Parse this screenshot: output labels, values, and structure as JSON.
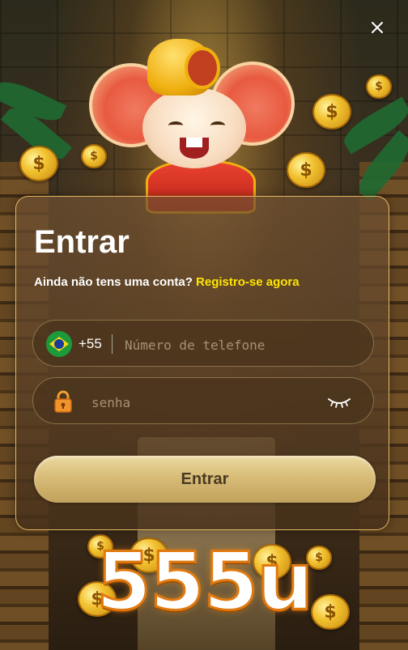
{
  "dialog": {
    "title": "Entrar",
    "register_prompt": "Ainda não tens uma conta?",
    "register_link": "Registro-se agora",
    "country_code": "+55",
    "phone_placeholder": "Número de telefone",
    "password_placeholder": "senha",
    "submit_label": "Entrar"
  },
  "brand": {
    "logo_text": "555u"
  },
  "icons": {
    "close": "close-icon",
    "flag": "brazil-flag-icon",
    "lock": "lock-icon",
    "eye": "eye-closed-icon",
    "coin_symbol": "$"
  },
  "colors": {
    "link": "#ffe600",
    "card_border": "#ffcd6e",
    "button": "#d8bc78",
    "logo_outline": "#e07a10"
  }
}
